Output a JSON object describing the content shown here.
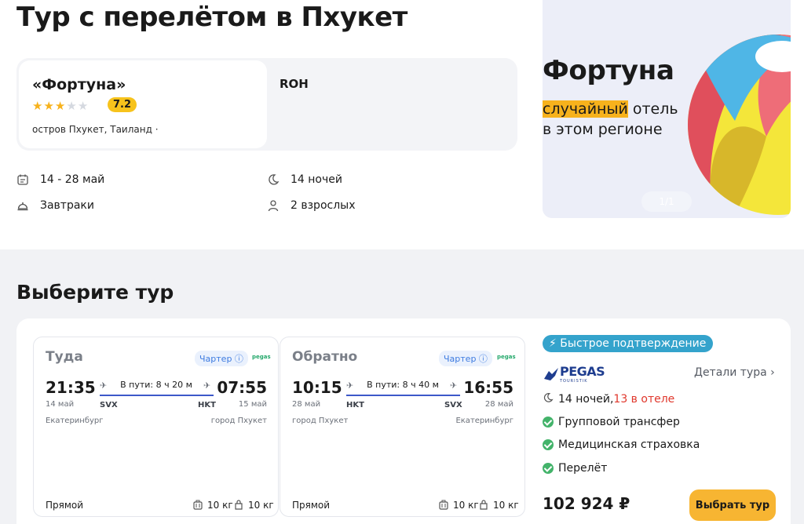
{
  "page": {
    "title": "Тур с перелётом в Пхукет"
  },
  "hotel": {
    "name": "«Фортуна»",
    "stars": 3,
    "stars_max": 5,
    "rating": "7.2",
    "location": "остров Пхукет, Таиланд ·",
    "room_type": "ROH"
  },
  "trip": {
    "dates": "14 - 28 май",
    "nights": "14 ночей",
    "meals": "Завтраки",
    "guests": "2 взрослых"
  },
  "promo": {
    "title": "Фортуна",
    "highlight": "случайный",
    "line1_rest": " отель",
    "line2": "в этом регионе",
    "counter": "1/1"
  },
  "section": {
    "title": "Выберите тур"
  },
  "outbound": {
    "label": "Туда",
    "charter": "Чартер",
    "airline": "pegas",
    "dep_time": "21:35",
    "dep_date": "14 май",
    "dep_code": "SVX",
    "dep_city": "Екатеринбург",
    "duration": "В пути: 8 ч 20 м",
    "arr_time": "07:55",
    "arr_date": "15 май",
    "arr_code": "HKT",
    "arr_city": "город Пхукет",
    "type": "Прямой",
    "carry_on": "10 кг",
    "baggage": "10 кг"
  },
  "inbound": {
    "label": "Обратно",
    "charter": "Чартер",
    "airline": "pegas",
    "dep_time": "10:15",
    "dep_date": "28 май",
    "dep_code": "HKT",
    "dep_city": "город Пхукет",
    "duration": "В пути: 8 ч 40 м",
    "arr_time": "16:55",
    "arr_date": "28 май",
    "arr_code": "SVX",
    "arr_city": "Екатеринбург",
    "type": "Прямой",
    "carry_on": "10 кг",
    "baggage": "10 кг"
  },
  "tour": {
    "fast_confirm": "Быстрое подтверждение",
    "operator": "PEGAS",
    "operator_sub": "TOURISTIK",
    "details": "Детали тура",
    "nights": "14 ночей, ",
    "nights_hotel": "13 в отеле",
    "features": [
      "Групповой трансфер",
      "Медицинская страховка",
      "Перелёт"
    ],
    "price": "102 924 ₽",
    "choose": "Выбрать тур"
  },
  "colors": {
    "accent": "#f7b532",
    "badge": "#34a3cc",
    "check": "#43b36a",
    "alert": "#e0372c",
    "route": "#3d58c9"
  }
}
